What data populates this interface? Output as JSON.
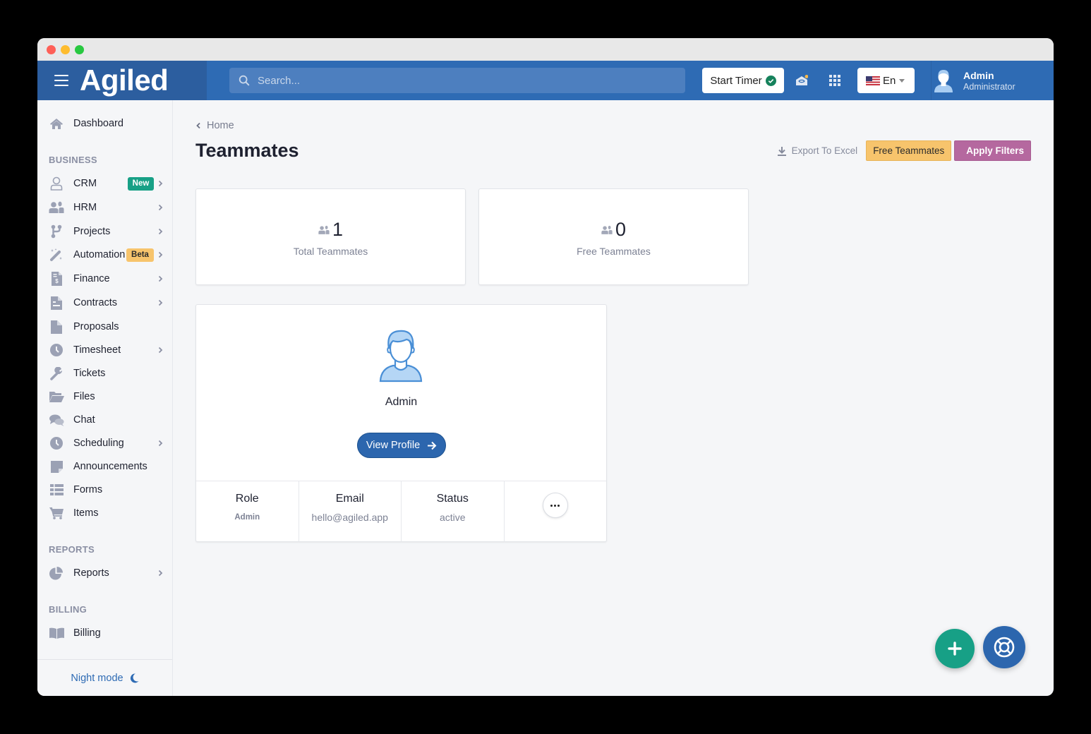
{
  "app": {
    "name": "Agiled",
    "brand_color": "#2e6bb4"
  },
  "topbar": {
    "search_placeholder": "Search...",
    "start_timer_label": "Start Timer",
    "language_label": "En",
    "user_name": "Admin",
    "user_role": "Administrator"
  },
  "sidebar": {
    "dashboard": "Dashboard",
    "sections": {
      "business": "BUSINESS",
      "reports": "REPORTS",
      "billing": "BILLING"
    },
    "items": [
      {
        "label": "CRM",
        "icon": "user-outline-icon",
        "has_submenu": true,
        "badge": "New"
      },
      {
        "label": "HRM",
        "icon": "users-icon",
        "has_submenu": true
      },
      {
        "label": "Projects",
        "icon": "branch-icon",
        "has_submenu": true
      },
      {
        "label": "Automation",
        "icon": "magic-wand-icon",
        "has_submenu": true,
        "badge": "Beta"
      },
      {
        "label": "Finance",
        "icon": "invoice-dollar-icon",
        "has_submenu": true
      },
      {
        "label": "Contracts",
        "icon": "contract-icon",
        "has_submenu": true
      },
      {
        "label": "Proposals",
        "icon": "file-icon",
        "has_submenu": false
      },
      {
        "label": "Timesheet",
        "icon": "clock-icon",
        "has_submenu": true
      },
      {
        "label": "Tickets",
        "icon": "wrench-icon",
        "has_submenu": false
      },
      {
        "label": "Files",
        "icon": "folder-open-icon",
        "has_submenu": false
      },
      {
        "label": "Chat",
        "icon": "chat-bubbles-icon",
        "has_submenu": false
      },
      {
        "label": "Scheduling",
        "icon": "clock-icon",
        "has_submenu": true
      },
      {
        "label": "Announcements",
        "icon": "sticky-note-icon",
        "has_submenu": false
      },
      {
        "label": "Forms",
        "icon": "list-icon",
        "has_submenu": false
      },
      {
        "label": "Items",
        "icon": "cart-icon",
        "has_submenu": false
      }
    ],
    "reports_item": "Reports",
    "billing_item": "Billing",
    "night_mode": "Night mode"
  },
  "page": {
    "breadcrumb": "Home",
    "title": "Teammates",
    "export_label": "Export To Excel",
    "free_teammates_label": "Free Teammates",
    "apply_filters_label": "Apply Filters"
  },
  "stats": [
    {
      "value": "1",
      "caption": "Total Teammates"
    },
    {
      "value": "0",
      "caption": "Free Teammates"
    }
  ],
  "members": [
    {
      "name": "Admin",
      "view_profile_label": "View Profile",
      "role_header": "Role",
      "role": "Admin",
      "email_header": "Email",
      "email": "hello@agiled.app",
      "status_header": "Status",
      "status": "active"
    }
  ],
  "colors": {
    "new_badge": "#17a086",
    "beta_badge": "#f7c46c",
    "free_teammates_btn": "#f7c46c",
    "apply_filters_btn": "#b5689f",
    "fab_add": "#17a086",
    "fab_help": "#2c66ae"
  }
}
